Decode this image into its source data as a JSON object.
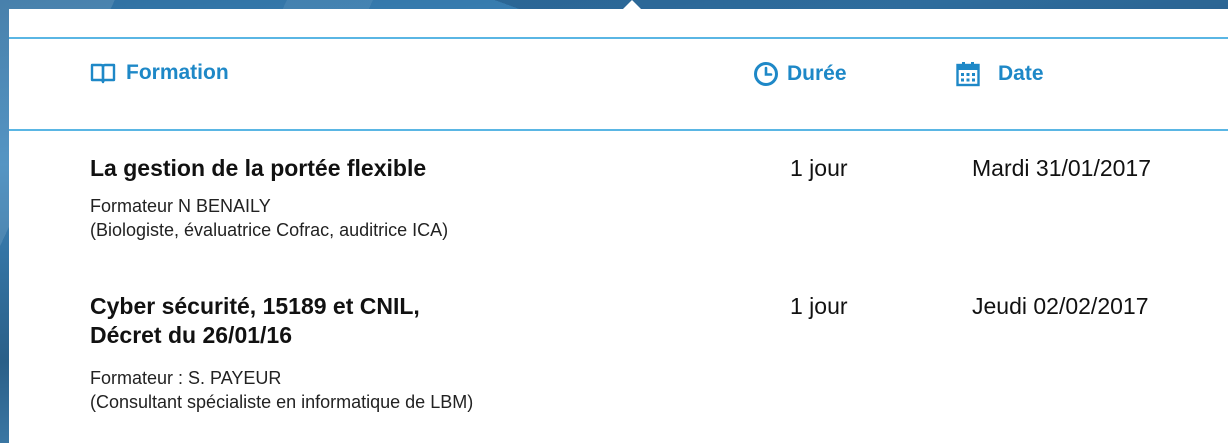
{
  "colors": {
    "accent": "#1e88c7",
    "divider": "#5ab6e4",
    "text": "#111111"
  },
  "header": {
    "formation_label": "Formation",
    "formation_icon": "book-icon",
    "duree_label": "Durée",
    "duree_icon": "clock-icon",
    "date_label": "Date",
    "date_icon": "calendar-icon"
  },
  "rows": [
    {
      "title_lines": [
        "La gestion de la portée flexible"
      ],
      "trainer": "Formateur N BENAILY",
      "trainer_detail": "(Biologiste, évaluatrice Cofrac, auditrice ICA)",
      "duration": "1 jour",
      "date": "Mardi 31/01/2017"
    },
    {
      "title_lines": [
        "Cyber sécurité, 15189 et CNIL,",
        "Décret du 26/01/16"
      ],
      "trainer": "Formateur : S. PAYEUR",
      "trainer_detail": "(Consultant spécialiste en informatique de LBM)",
      "duration": "1 jour",
      "date": "Jeudi 02/02/2017"
    }
  ]
}
